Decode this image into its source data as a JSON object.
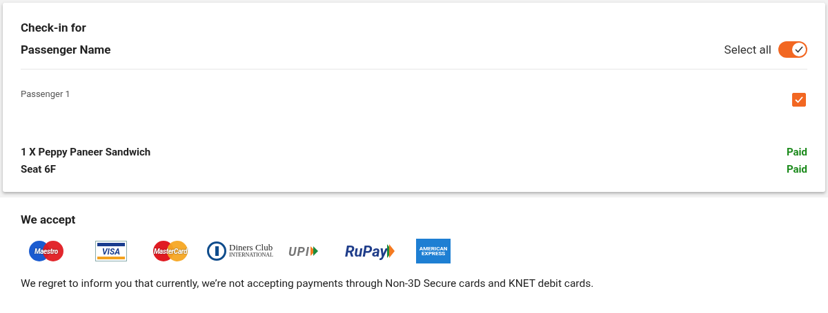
{
  "checkin": {
    "title": "Check-in for",
    "subtitle": "Passenger Name",
    "select_all": {
      "label": "Select all",
      "on": true
    },
    "passengers": [
      {
        "label": "Passenger 1",
        "checked": true,
        "items": [
          {
            "name": "1 X Peppy Paneer Sandwich",
            "status": "Paid"
          },
          {
            "name": "Seat 6F",
            "status": "Paid"
          }
        ]
      }
    ]
  },
  "payment": {
    "title": "We accept",
    "cards": [
      {
        "kind": "maestro",
        "label": "Maestro"
      },
      {
        "kind": "visa",
        "label": "VISA"
      },
      {
        "kind": "mastercard",
        "label": "MasterCard"
      },
      {
        "kind": "diners",
        "label": "Diners Club",
        "sub": "INTERNATIONAL"
      },
      {
        "kind": "upi",
        "label": "UPI"
      },
      {
        "kind": "rupay",
        "label": "RuPay"
      },
      {
        "kind": "amex",
        "label": "AMERICAN",
        "sub": "EXPRESS"
      }
    ],
    "notice": "We regret to inform you that currently, we’re not accepting payments through Non-3D Secure cards and KNET debit cards."
  }
}
